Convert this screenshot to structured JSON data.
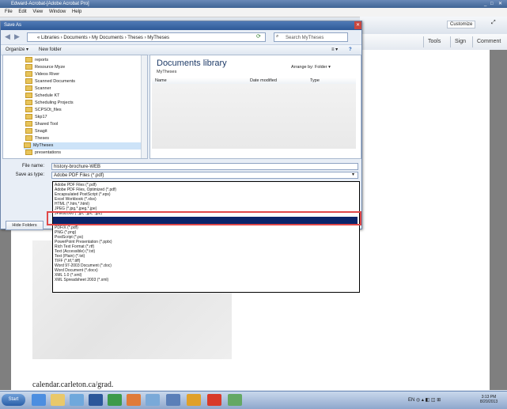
{
  "app": {
    "title": "Edward-Acrobat-[Adobe Acrobat Pro]",
    "menu": [
      "File",
      "Edit",
      "View",
      "Window",
      "Help"
    ],
    "customize": "Customize",
    "tabs": [
      "Tools",
      "Sign",
      "Comment"
    ]
  },
  "dialog": {
    "title": "Save As",
    "address_path": "« Libraries › Documents › My Documents › Theses › MyTheses",
    "search_placeholder": "Search MyTheses",
    "organize": "Organize ▾",
    "new_folder": "New folder",
    "nav_items": [
      "reports",
      "Resource Myze",
      "Videos River",
      "Scanned Documents",
      "Scanner",
      "Schedule KT",
      "Scheduling Projects",
      "SCPSOt_files",
      "Skp17",
      "Shared Tool",
      "Snagit",
      "Theses",
      "MyTheses",
      "presentations"
    ],
    "library_title": "Documents library",
    "library_sub": "MyTheses",
    "arrange_by": "Arrange by:  Folder ▾",
    "columns": [
      "Name",
      "Date modified",
      "Type"
    ],
    "file_name_label": "File name:",
    "file_name_value": "history-brochure-WEB",
    "save_type_label": "Save as type:",
    "save_type_value": "Adobe PDF Files (*.pdf)",
    "hide_folders": "Hide Folders",
    "type_options": [
      "Adobe PDF Files (*.pdf)",
      "Adobe PDF Files, Optimized (*.pdf)",
      "Encapsulated PostScript (*.eps)",
      "Excel Workbook (*.xlsx)",
      "HTML (*.htm,*.html)",
      "JPEG (*.jpg,*.jpeg,*.jpe)",
      "JPEG2000 (*.jpf,*.jpx,*.jp2)",
      "",
      "",
      "PDF/X (*.pdf)",
      "PNG (*.png)",
      "PostScript (*.ps)",
      "PowerPoint Presentation (*.pptx)",
      "Rich Text Format (*.rtf)",
      "Text (Accessible) (*.txt)",
      "Text (Plain) (*.txt)",
      "TIFF (*.tif,*.tiff)",
      "Word 97-2003 Document (*.doc)",
      "Word Document (*.docx)",
      "XML 1.0 (*.xml)",
      "XML Spreadsheet 2003 (*.xml)"
    ]
  },
  "document": {
    "caption": "calendar.carleton.ca/grad."
  },
  "taskbar": {
    "start": "Start",
    "time": "3:13 PM",
    "date": "8/20/2013"
  },
  "colors": {
    "highlight_box": "#e04848",
    "selected_option": "#0a246a",
    "dialog_bg": "#e8eef6"
  }
}
